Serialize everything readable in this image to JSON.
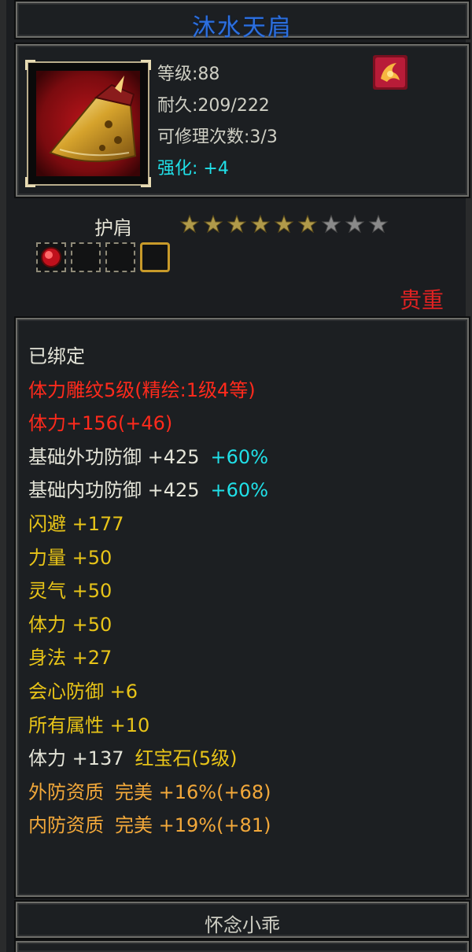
{
  "item_name": "沐水天肩",
  "stats": {
    "level": "等级:88",
    "durability": "耐久:209/222",
    "repair": "可修理次数:3/3",
    "enhance_label": "强化:",
    "enhance_value": "+4"
  },
  "item_type": "护肩",
  "stars": {
    "filled": 6,
    "total": 9
  },
  "sockets": [
    "ruby",
    "empty",
    "empty",
    "gold"
  ],
  "rarity": "贵重",
  "attributes": [
    {
      "parts": [
        {
          "text": "已绑定",
          "color": "white"
        }
      ]
    },
    {
      "parts": [
        {
          "text": "体力雕纹5级(精绘:1级4等)",
          "color": "red"
        }
      ]
    },
    {
      "parts": [
        {
          "text": "体力+156(+46)",
          "color": "red"
        }
      ]
    },
    {
      "parts": [
        {
          "text": "基础外功防御 +425",
          "color": "white"
        },
        {
          "text": "+60%",
          "color": "cyan"
        }
      ]
    },
    {
      "parts": [
        {
          "text": "基础内功防御 +425",
          "color": "white"
        },
        {
          "text": "+60%",
          "color": "cyan"
        }
      ]
    },
    {
      "parts": [
        {
          "text": "闪避 +177",
          "color": "yellow"
        }
      ]
    },
    {
      "parts": [
        {
          "text": "力量 +50",
          "color": "yellow"
        }
      ]
    },
    {
      "parts": [
        {
          "text": "灵气 +50",
          "color": "yellow"
        }
      ]
    },
    {
      "parts": [
        {
          "text": "体力 +50",
          "color": "yellow"
        }
      ]
    },
    {
      "parts": [
        {
          "text": "身法 +27",
          "color": "yellow"
        }
      ]
    },
    {
      "parts": [
        {
          "text": "会心防御 +6",
          "color": "yellow"
        }
      ]
    },
    {
      "parts": [
        {
          "text": "所有属性 +10",
          "color": "yellow"
        }
      ]
    },
    {
      "parts": [
        {
          "text": "体力 +137",
          "color": "white"
        },
        {
          "text": "红宝石(5级)",
          "color": "yellow"
        }
      ]
    },
    {
      "parts": [
        {
          "text": "外防资质",
          "color": "orange"
        },
        {
          "text": "完美 +16%(+68)",
          "color": "orange"
        }
      ]
    },
    {
      "parts": [
        {
          "text": "内防资质",
          "color": "orange"
        },
        {
          "text": "完美 +19%(+81)",
          "color": "orange"
        }
      ]
    }
  ],
  "owner": "怀念小乖",
  "colors": {
    "title": "#2c6fe0",
    "rarity": "#e02222",
    "enhance": "#20e0e8"
  },
  "icons": {
    "item": "shoulder-armor-icon",
    "badge": "enhance-badge-icon",
    "star": "star-icon",
    "socket_gem": "ruby-gem-icon"
  }
}
